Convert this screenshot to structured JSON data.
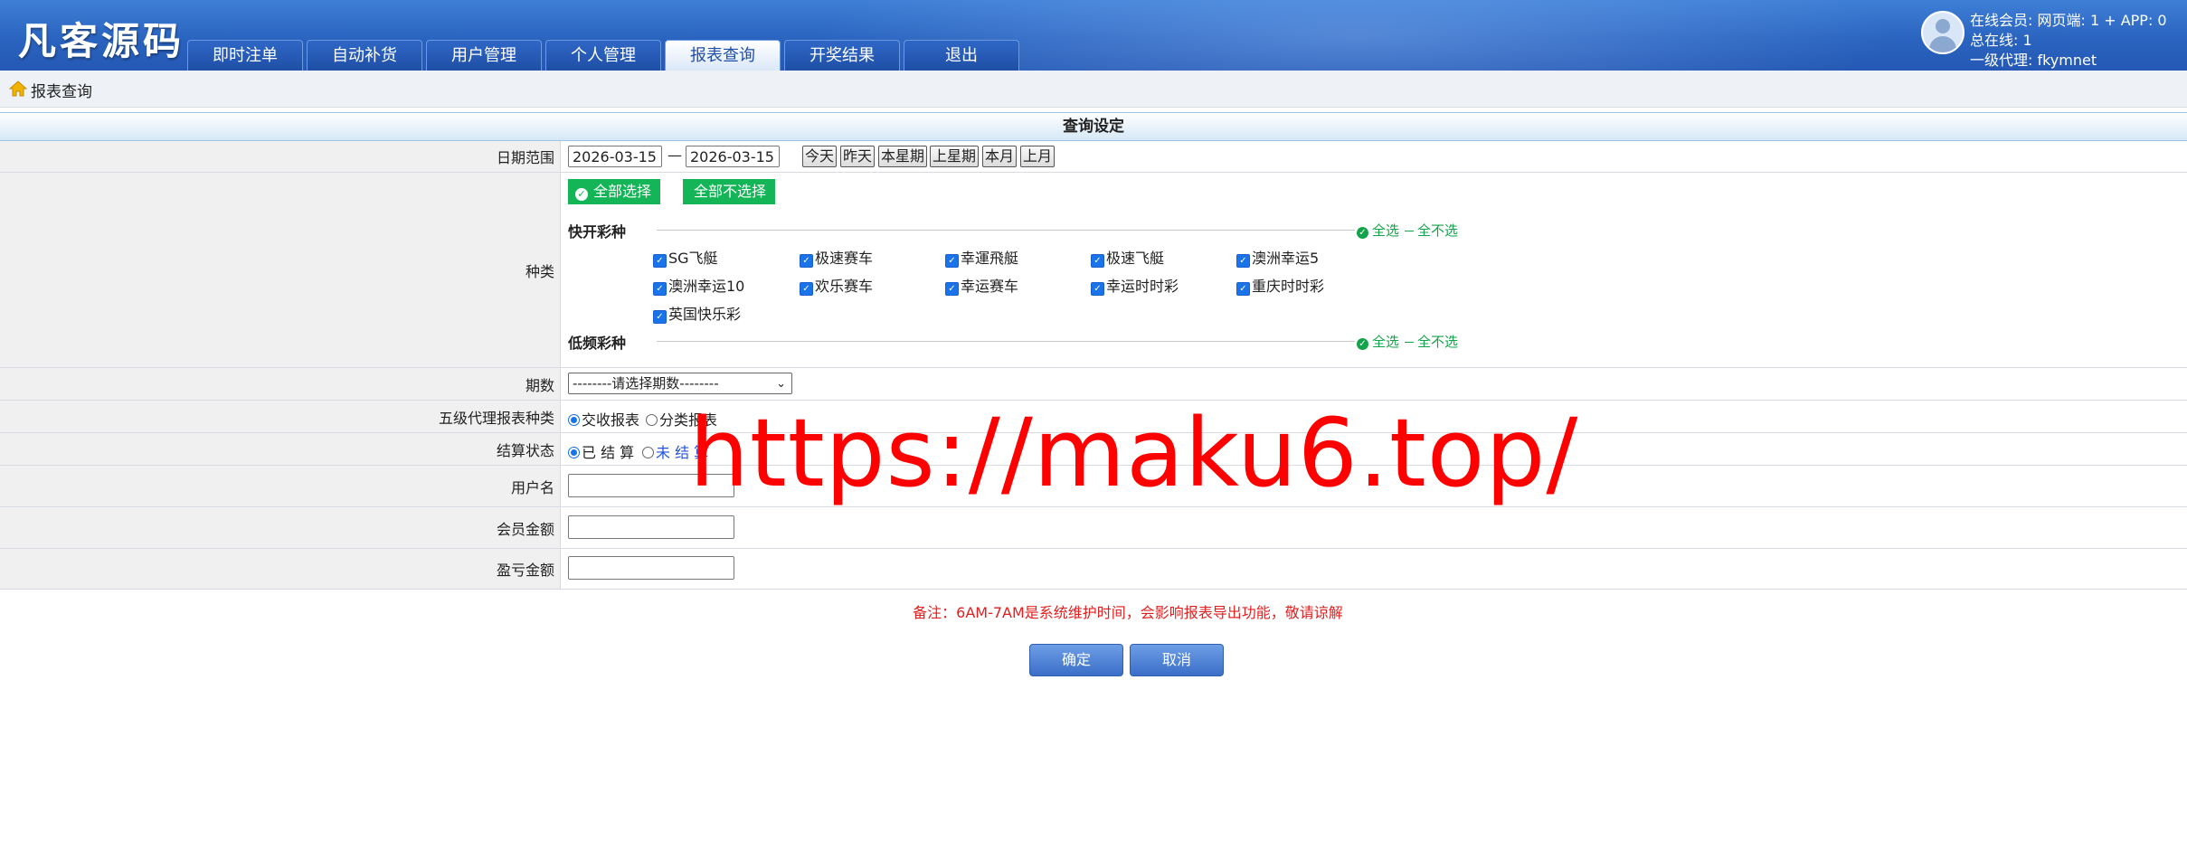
{
  "header": {
    "logo": "凡客源码",
    "tabs": [
      {
        "label": "即时注单",
        "active": false
      },
      {
        "label": "自动补货",
        "active": false
      },
      {
        "label": "用户管理",
        "active": false
      },
      {
        "label": "个人管理",
        "active": false
      },
      {
        "label": "报表查询",
        "active": true
      },
      {
        "label": "开奖结果",
        "active": false
      },
      {
        "label": "退出",
        "active": false
      }
    ],
    "user": {
      "line1": "在线会员:  网页端: 1 + APP: 0",
      "line2": "总在线: 1",
      "line3": "一级代理: fkymnet"
    }
  },
  "breadcrumb": {
    "label": "报表查询"
  },
  "form": {
    "section_title": "查询设定",
    "date": {
      "label": "日期范围",
      "from": "2026-03-15",
      "sep": "—",
      "to": "2026-03-15",
      "quick": [
        "今天",
        "昨天",
        "本星期",
        "上星期",
        "本月",
        "上月"
      ]
    },
    "types": {
      "label": "种类",
      "select_all_btn": "全部选择",
      "deselect_all_btn": "全部不选择",
      "groups": [
        {
          "name": "快开彩种",
          "select_all": "全选",
          "select_none": "全不选",
          "items": [
            "SG飞艇",
            "极速赛车",
            "幸運飛艇",
            "极速飞艇",
            "澳洲幸运5",
            "澳洲幸运10",
            "欢乐赛车",
            "幸运赛车",
            "幸运时时彩",
            "重庆时时彩",
            "英国快乐彩"
          ]
        },
        {
          "name": "低频彩种",
          "select_all": "全选",
          "select_none": "全不选",
          "items": []
        }
      ]
    },
    "period": {
      "label": "期数",
      "selected": "--------请选择期数--------"
    },
    "report_type": {
      "label": "五级代理报表种类",
      "options": [
        "交收报表",
        "分类报表"
      ],
      "selected": 0
    },
    "settle": {
      "label": "结算状态",
      "options": [
        "已 结 算",
        "未 结 算"
      ],
      "selected": 0
    },
    "username": {
      "label": "用户名",
      "value": ""
    },
    "member_amount": {
      "label": "会员金额",
      "value": ""
    },
    "profit_amount": {
      "label": "盈亏金额",
      "value": ""
    },
    "note": "备注：6AM-7AM是系统维护时间，会影响报表导出功能，敬请谅解",
    "confirm": "确定",
    "cancel": "取消"
  },
  "watermark": "https://maku6.top/",
  "colors": {
    "accent_blue": "#2a64c0",
    "green": "#13b556",
    "note_red": "#e02020",
    "watermark_red": "#ff0000"
  }
}
